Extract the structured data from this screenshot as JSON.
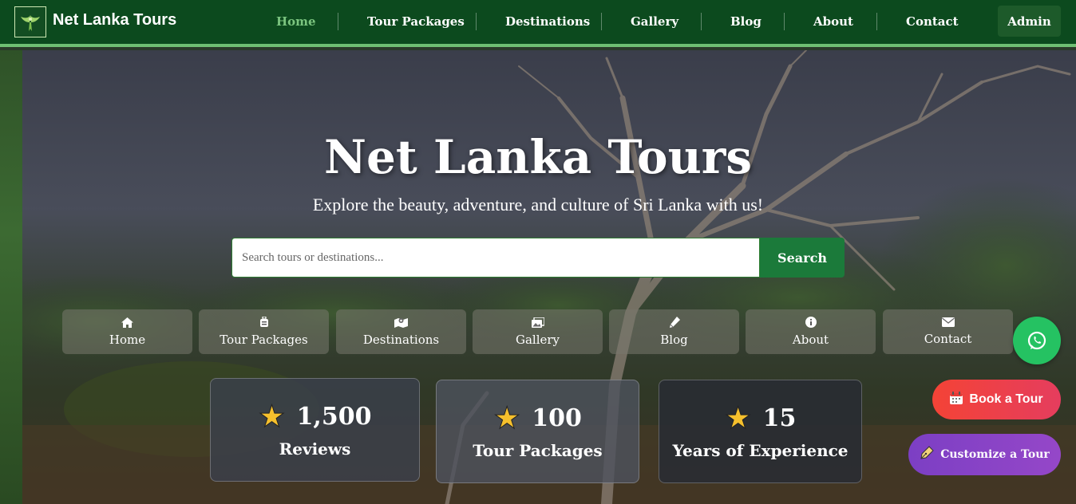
{
  "navbar": {
    "brand": "Net Lanka Tours",
    "logo_icon": "winged-logo-icon",
    "items": [
      {
        "label": "Home",
        "active": true
      },
      {
        "label": "Tour Packages",
        "active": false
      },
      {
        "label": "Destinations",
        "active": false
      },
      {
        "label": "Gallery",
        "active": false
      },
      {
        "label": "Blog",
        "active": false
      },
      {
        "label": "About",
        "active": false
      },
      {
        "label": "Contact",
        "active": false
      }
    ],
    "admin_label": "Admin"
  },
  "hero": {
    "title": "Net Lanka Tours",
    "subtitle": "Explore the beauty, adventure, and culture of Sri Lanka with us!",
    "search": {
      "placeholder": "Search tours or destinations...",
      "value": "",
      "button_label": "Search"
    }
  },
  "quick_nav": [
    {
      "label": "Home",
      "icon": "home-icon"
    },
    {
      "label": "Tour Packages",
      "icon": "suitcase-icon"
    },
    {
      "label": "Destinations",
      "icon": "map-marker-icon"
    },
    {
      "label": "Gallery",
      "icon": "images-icon"
    },
    {
      "label": "Blog",
      "icon": "pen-icon"
    },
    {
      "label": "About",
      "icon": "info-icon"
    },
    {
      "label": "Contact",
      "icon": "envelope-icon"
    }
  ],
  "stats": [
    {
      "value": "1,500",
      "label": "Reviews",
      "icon": "star-icon"
    },
    {
      "value": "100",
      "label": "Tour Packages",
      "icon": "star-icon"
    },
    {
      "value": "15",
      "label": "Years of Experience",
      "icon": "star-icon"
    }
  ],
  "floating": {
    "whatsapp_icon": "whatsapp-icon",
    "book_label": "Book a Tour",
    "customize_label": "Customize a Tour"
  },
  "colors": {
    "navbar_bg": "#0c4a1e",
    "nav_active": "#7bc47f",
    "search_button": "#1b7a3a",
    "whatsapp": "#25c262",
    "book_button": "#f44336",
    "customize_button": "#7c3fc4",
    "star": "#f6c02d"
  }
}
